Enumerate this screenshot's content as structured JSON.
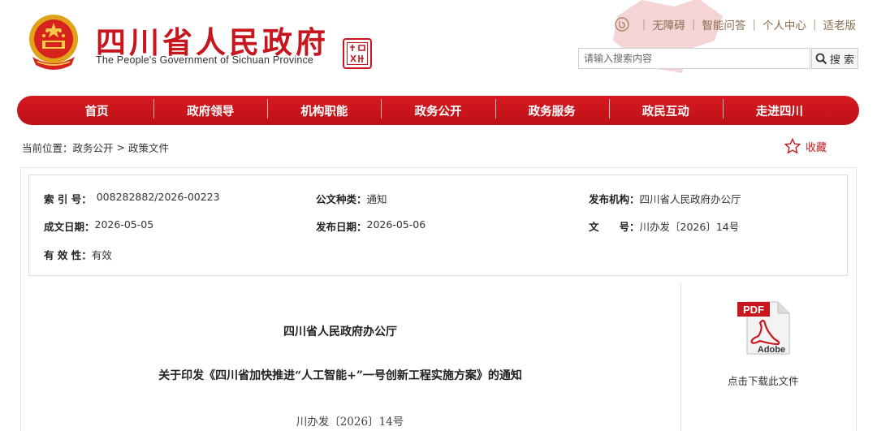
{
  "header": {
    "site_title": "四川省人民政府",
    "site_subtitle": "The People's Government of Sichuan Province",
    "seal_text": "中国四川",
    "links": [
      "无障碍",
      "智能问答",
      "个人中心",
      "适老版"
    ],
    "search_placeholder": "请输入搜索内容",
    "search_button": "搜 索"
  },
  "nav": {
    "items": [
      "首页",
      "政府领导",
      "机构职能",
      "政务公开",
      "政务服务",
      "政民互动",
      "走进四川"
    ]
  },
  "breadcrumb": {
    "prefix": "当前位置：",
    "items": [
      "政务公开",
      "政策文件"
    ],
    "separator": ">"
  },
  "favorite_label": "收藏",
  "meta": {
    "index_label": "索 引 号：",
    "index_value": "008282882/2026-00223",
    "category_label": "公文种类：",
    "category_value": "通知",
    "issuer_label": "发布机构：",
    "issuer_value": "四川省人民政府办公厅",
    "created_label": "成文日期：",
    "created_value": "2026-05-05",
    "published_label": "发布日期：",
    "published_value": "2026-05-06",
    "docno_label": "文　　号：",
    "docno_value": "川办发〔2026〕14号",
    "validity_label": "有 效 性：",
    "validity_value": "有效"
  },
  "document": {
    "issuer": "四川省人民政府办公厅",
    "title": "关于印发《四川省加快推进“人工智能+”一号创新工程实施方案》的通知",
    "number": "川办发〔2026〕14号"
  },
  "download": {
    "icon": "pdf-icon",
    "pdf_tag": "PDF",
    "adobe_text": "Adobe",
    "label": "点击下载此文件"
  },
  "colors": {
    "brand_red": "#c8161e",
    "link_brown": "#8a6d4e"
  }
}
